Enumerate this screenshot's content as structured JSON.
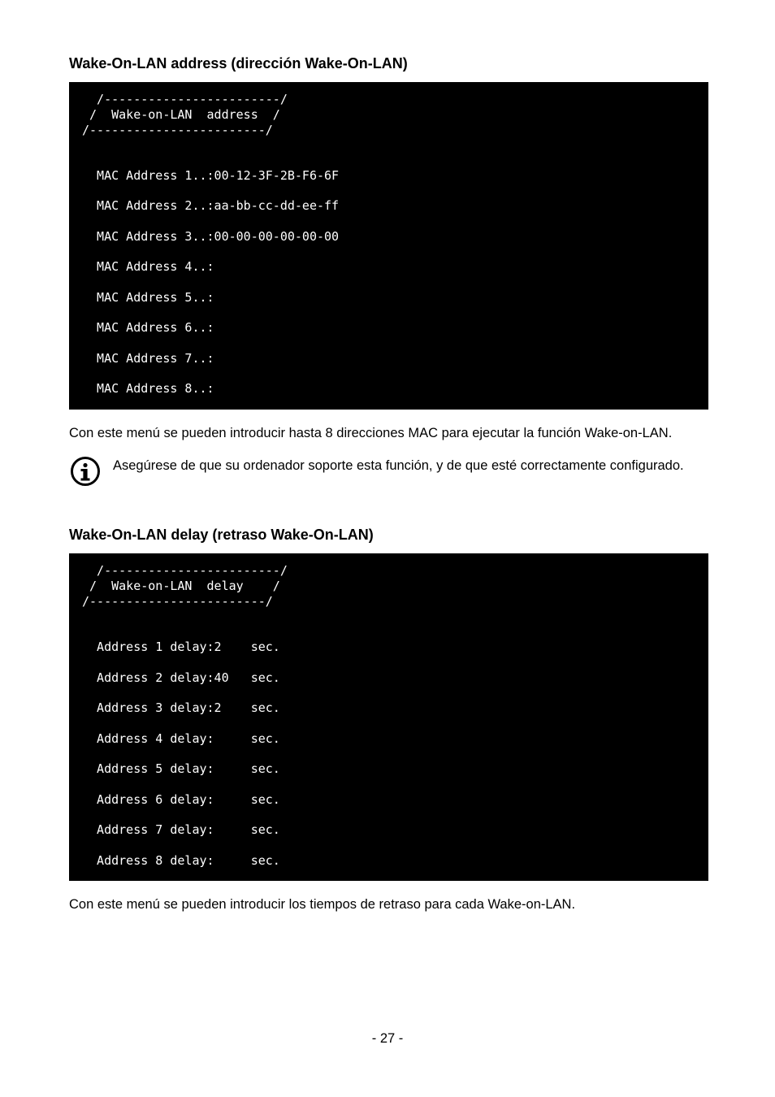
{
  "section1": {
    "heading": "Wake-On-LAN address (dirección Wake-On-LAN)",
    "term": "  /------------------------/\n /  Wake-on-LAN  address  /\n/------------------------/\n\n\n  MAC Address 1..:00-12-3F-2B-F6-6F\n\n  MAC Address 2..:aa-bb-cc-dd-ee-ff\n\n  MAC Address 3..:00-00-00-00-00-00\n\n  MAC Address 4..:\n\n  MAC Address 5..:\n\n  MAC Address 6..:\n\n  MAC Address 7..:\n\n  MAC Address 8..:",
    "para": "Con este menú se pueden introducir hasta 8 direcciones MAC para ejecutar la función Wake-on-LAN.",
    "note": "Asegúrese de que su ordenador soporte esta función, y de que esté correctamente configurado."
  },
  "section2": {
    "heading": "Wake-On-LAN delay (retraso Wake-On-LAN)",
    "term": "  /------------------------/\n /  Wake-on-LAN  delay    /\n/------------------------/\n\n\n  Address 1 delay:2    sec.\n\n  Address 2 delay:40   sec.\n\n  Address 3 delay:2    sec.\n\n  Address 4 delay:     sec.\n\n  Address 5 delay:     sec.\n\n  Address 6 delay:     sec.\n\n  Address 7 delay:     sec.\n\n  Address 8 delay:     sec.",
    "para": "Con este menú se pueden introducir los tiempos de retraso para cada Wake-on-LAN."
  },
  "pageNumber": "- 27 -"
}
